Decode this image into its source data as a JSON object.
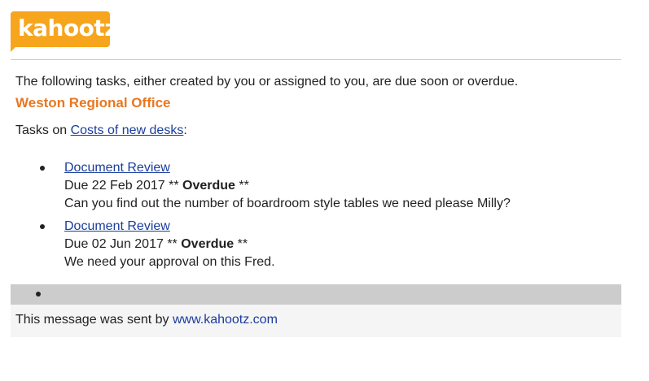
{
  "brand": {
    "logo_text": "kahootz",
    "logo_color": "#f7a51d"
  },
  "message": {
    "intro": "The following tasks, either created by you or assigned to you, are due soon or overdue.",
    "office_name": "Weston Regional Office",
    "tasks_on_prefix": "Tasks on ",
    "tasks_on_link": "Costs of new desks",
    "tasks_on_suffix": ":"
  },
  "tasks": [
    {
      "title": "Document Review",
      "due_prefix": "Due 22 Feb 2017 ** ",
      "status": "Overdue",
      "status_suffix": " **",
      "description": "Can you find out the number of boardroom style tables we need please Milly?"
    },
    {
      "title": "Document Review",
      "due_prefix": "Due 02 Jun 2017 ** ",
      "status": "Overdue",
      "status_suffix": " **",
      "description": "We need your approval on this Fred."
    }
  ],
  "footer": {
    "text_prefix": "This message was sent by ",
    "link": "www.kahootz.com"
  },
  "colors": {
    "accent_orange": "#e87722",
    "link_blue": "#1a3d9c",
    "bar_gray": "#cccccc",
    "footer_bg": "#f5f5f5"
  }
}
